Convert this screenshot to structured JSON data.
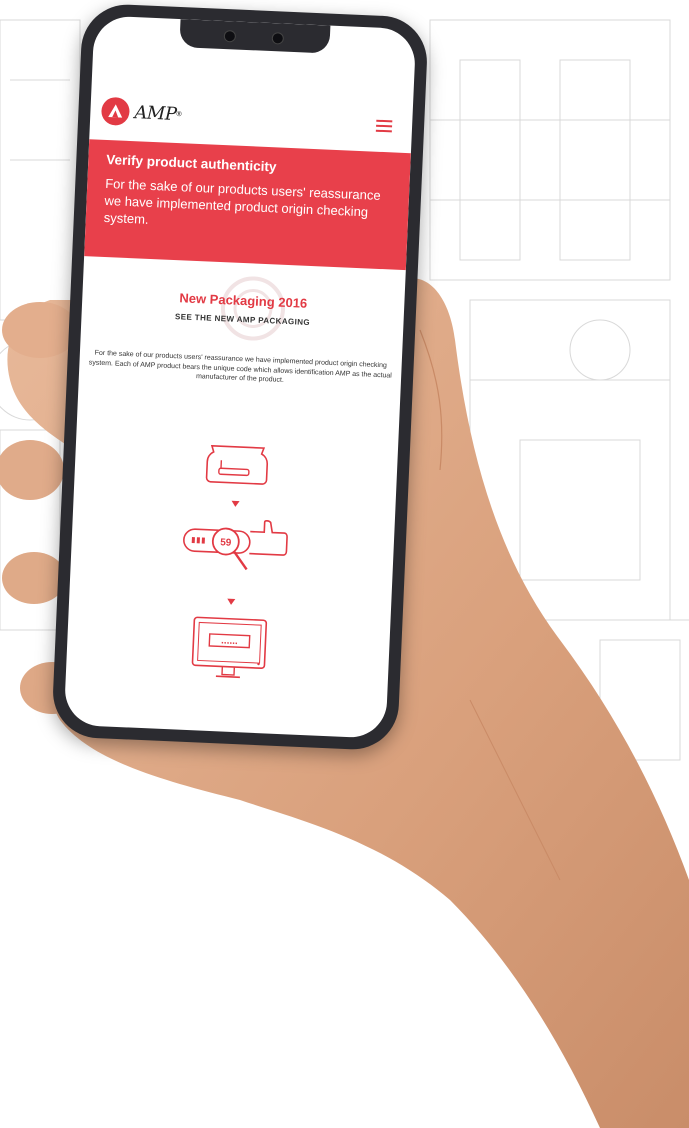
{
  "header": {
    "logo_text": "AMP",
    "logo_reg": "®"
  },
  "banner": {
    "title": "Verify product authenticity",
    "text": "For the sake of our products users' reassurance we have implemented product origin checking system."
  },
  "content": {
    "title": "New Packaging 2016",
    "subtitle": "SEE THE NEW AMP PACKAGING",
    "description": "For the sake of our products users' reassurance we have implemented product origin checking system. Each of AMP product bears the unique code which allows identification AMP as the actual manufacturer of the product.",
    "steps": [
      {
        "icon": "package-icon"
      },
      {
        "icon": "scratch-code-magnifier-icon",
        "code_text": "59"
      },
      {
        "icon": "computer-monitor-icon",
        "screen_text": "......"
      }
    ]
  },
  "colors": {
    "accent": "#e8404b",
    "icon_red": "#e23a44",
    "phone_frame": "#2b2b30"
  }
}
